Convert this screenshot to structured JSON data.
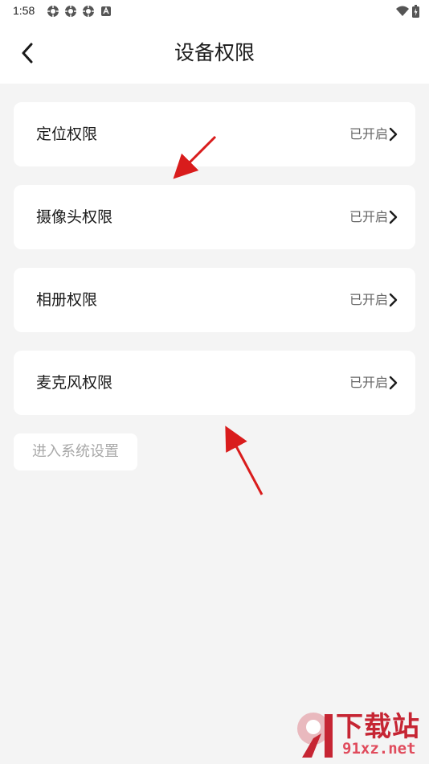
{
  "status_bar": {
    "time": "1:58",
    "left_icons": [
      "settings-cog-icon",
      "settings-cog-icon",
      "settings-cog-icon",
      "app-badge-icon"
    ],
    "right_icons": [
      "wifi-icon",
      "battery-charging-icon"
    ]
  },
  "header": {
    "title": "设备权限",
    "back_icon": "chevron-left-icon"
  },
  "permissions": [
    {
      "label": "定位权限",
      "status": "已开启"
    },
    {
      "label": "摄像头权限",
      "status": "已开启"
    },
    {
      "label": "相册权限",
      "status": "已开启"
    },
    {
      "label": "麦克风权限",
      "status": "已开启"
    }
  ],
  "system_settings_button": "进入系统设置",
  "annotations": {
    "arrow_color": "#d91c1c"
  },
  "watermark": {
    "title": "下载站",
    "domain": "91xz.net",
    "logo_text": "9"
  },
  "colors": {
    "background": "#f4f4f4",
    "card": "#ffffff",
    "status_text": "#666666",
    "watermark": "#c62533"
  }
}
